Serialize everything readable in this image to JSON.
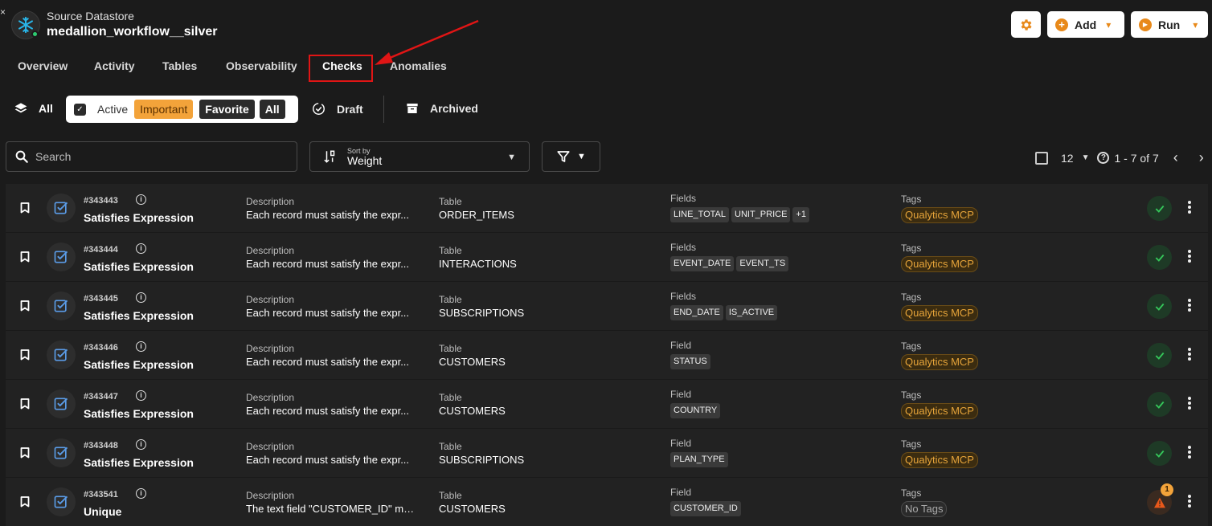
{
  "header": {
    "datastore_type": "Source Datastore",
    "datastore_name": "medallion_workflow__silver",
    "add_label": "Add",
    "run_label": "Run",
    "back_glyph": "×"
  },
  "tabs": [
    {
      "label": "Overview"
    },
    {
      "label": "Activity"
    },
    {
      "label": "Tables"
    },
    {
      "label": "Observability"
    },
    {
      "label": "Checks"
    },
    {
      "label": "Anomalies"
    }
  ],
  "filters": {
    "all_label": "All",
    "active_label": "Active",
    "important_label": "Important",
    "favorite_label": "Favorite",
    "group_all_label": "All",
    "draft_label": "Draft",
    "archived_label": "Archived"
  },
  "toolbar": {
    "search_placeholder": "Search",
    "sort_by_label": "Sort by",
    "sort_by_value": "Weight",
    "page_size": "12",
    "range_text": "1 - 7 of 7"
  },
  "labels": {
    "description": "Description",
    "table": "Table",
    "fields": "Fields",
    "field": "Field",
    "tags": "Tags"
  },
  "checks": [
    {
      "id": "#343443",
      "name": "Satisfies Expression",
      "description": "Each record must satisfy the expr...",
      "table": "ORDER_ITEMS",
      "fields_label": "Fields",
      "fields": [
        "LINE_TOTAL",
        "UNIT_PRICE",
        "+1"
      ],
      "tag": "Qualytics MCP",
      "status": "ok"
    },
    {
      "id": "#343444",
      "name": "Satisfies Expression",
      "description": "Each record must satisfy the expr...",
      "table": "INTERACTIONS",
      "fields_label": "Fields",
      "fields": [
        "EVENT_DATE",
        "EVENT_TS"
      ],
      "tag": "Qualytics MCP",
      "status": "ok"
    },
    {
      "id": "#343445",
      "name": "Satisfies Expression",
      "description": "Each record must satisfy the expr...",
      "table": "SUBSCRIPTIONS",
      "fields_label": "Fields",
      "fields": [
        "END_DATE",
        "IS_ACTIVE"
      ],
      "tag": "Qualytics MCP",
      "status": "ok"
    },
    {
      "id": "#343446",
      "name": "Satisfies Expression",
      "description": "Each record must satisfy the expr...",
      "table": "CUSTOMERS",
      "fields_label": "Field",
      "fields": [
        "STATUS"
      ],
      "tag": "Qualytics MCP",
      "status": "ok"
    },
    {
      "id": "#343447",
      "name": "Satisfies Expression",
      "description": "Each record must satisfy the expr...",
      "table": "CUSTOMERS",
      "fields_label": "Field",
      "fields": [
        "COUNTRY"
      ],
      "tag": "Qualytics MCP",
      "status": "ok"
    },
    {
      "id": "#343448",
      "name": "Satisfies Expression",
      "description": "Each record must satisfy the expr...",
      "table": "SUBSCRIPTIONS",
      "fields_label": "Field",
      "fields": [
        "PLAN_TYPE"
      ],
      "tag": "Qualytics MCP",
      "status": "ok"
    },
    {
      "id": "#343541",
      "name": "Unique",
      "description": "The text field \"CUSTOMER_ID\" mu...",
      "table": "CUSTOMERS",
      "fields_label": "Field",
      "fields": [
        "CUSTOMER_ID"
      ],
      "tag": "No Tags",
      "status": "warn",
      "anomaly_count": "1"
    }
  ],
  "colors": {
    "accent": "#e8891a",
    "important": "#f3a33a",
    "ok": "#35c75a",
    "warn": "#e8581a",
    "highlight": "#e01515"
  }
}
